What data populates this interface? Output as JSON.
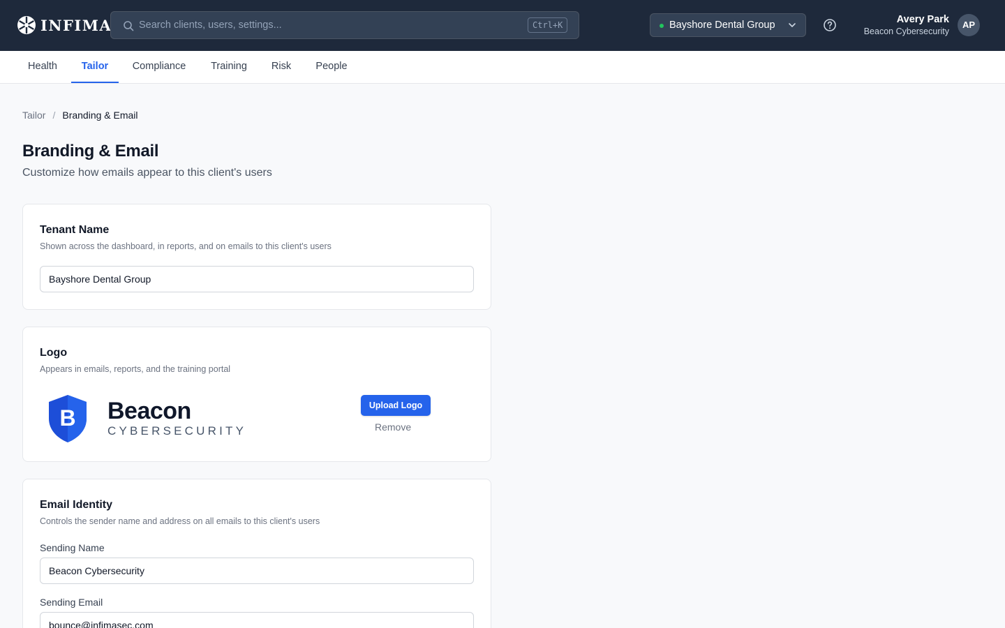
{
  "app": {
    "name": "INFIMA"
  },
  "search": {
    "placeholder": "Search clients, users, settings...",
    "shortcut": "Ctrl+K"
  },
  "tenant_selector": {
    "selected": "Bayshore Dental Group",
    "status_color": "#22c55e"
  },
  "user": {
    "name": "Avery Park",
    "org": "Beacon Cybersecurity",
    "initials": "AP"
  },
  "tabs": [
    {
      "label": "Health"
    },
    {
      "label": "Tailor",
      "active": true
    },
    {
      "label": "Compliance"
    },
    {
      "label": "Training"
    },
    {
      "label": "Risk"
    },
    {
      "label": "People"
    }
  ],
  "breadcrumb": {
    "parent": "Tailor",
    "separator": "/",
    "current": "Branding & Email"
  },
  "page": {
    "title": "Branding & Email",
    "subtitle": "Customize how emails appear to this client's users"
  },
  "tenant_card": {
    "title": "Tenant Name",
    "description": "Shown across the dashboard, in reports, and on emails to this client's users",
    "value": "Bayshore Dental Group"
  },
  "logo_card": {
    "title": "Logo",
    "description": "Appears in emails, reports, and the training portal",
    "brand_letter": "B",
    "brand_name": "Beacon",
    "brand_tagline": "CYBERSECURITY",
    "upload_label": "Upload Logo",
    "remove_label": "Remove"
  },
  "email_card": {
    "title": "Email Identity",
    "description": "Controls the sender name and address on all emails to this client's users",
    "sending_name_label": "Sending Name",
    "sending_name_value": "Beacon Cybersecurity",
    "sending_email_label": "Sending Email",
    "sending_email_value": "bounce@infimasec.com"
  },
  "colors": {
    "nav_bg": "#1e293b",
    "accent": "#2563eb",
    "page_bg": "#f8f9fb"
  }
}
